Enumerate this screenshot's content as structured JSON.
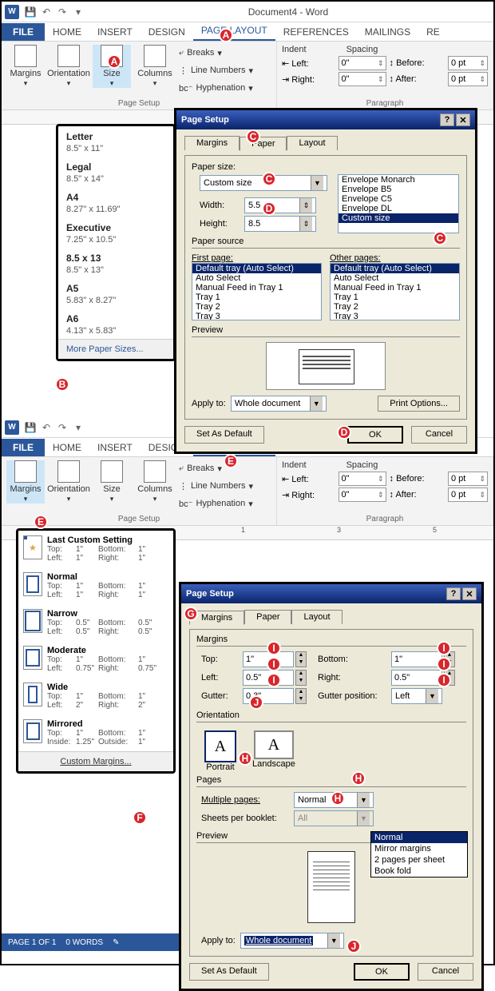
{
  "title": "Document4 - Word",
  "tabs": {
    "file": "FILE",
    "home": "HOME",
    "insert": "INSERT",
    "design": "DESIGN",
    "pagelayout": "PAGE LAYOUT",
    "references": "REFERENCES",
    "mailings": "MAILINGS",
    "re": "RE"
  },
  "ribbon": {
    "margins": "Margins",
    "orientation": "Orientation",
    "size": "Size",
    "columns": "Columns",
    "breaks": "Breaks",
    "linenumbers": "Line Numbers",
    "hyphenation": "Hyphenation",
    "pagesetup_label": "Page Setup",
    "indent_header": "Indent",
    "spacing_header": "Spacing",
    "left": "Left:",
    "right": "Right:",
    "before": "Before:",
    "after": "After:",
    "zero_in": "0\"",
    "zero_pt": "0 pt",
    "paragraph_label": "Paragraph"
  },
  "size_menu": {
    "letter": {
      "name": "Letter",
      "dim": "8.5\" x 11\""
    },
    "legal": {
      "name": "Legal",
      "dim": "8.5\" x 14\""
    },
    "a4": {
      "name": "A4",
      "dim": "8.27\" x 11.69\""
    },
    "executive": {
      "name": "Executive",
      "dim": "7.25\" x 10.5\""
    },
    "r85x13": {
      "name": "8.5 x 13",
      "dim": "8.5\" x 13\""
    },
    "a5": {
      "name": "A5",
      "dim": "5.83\" x 8.27\""
    },
    "a6": {
      "name": "A6",
      "dim": "4.13\" x 5.83\""
    },
    "more": "More Paper Sizes..."
  },
  "dlg1": {
    "title": "Page Setup",
    "tabs": {
      "margins": "Margins",
      "paper": "Paper",
      "layout": "Layout"
    },
    "paper_size": "Paper size:",
    "custom": "Custom size",
    "width": "Width:",
    "height": "Height:",
    "wval": "5.5",
    "hval": "8.5",
    "env_monarch": "Envelope Monarch",
    "env_b5": "Envelope B5",
    "env_c5": "Envelope C5",
    "env_dl": "Envelope DL",
    "paper_source": "Paper source",
    "first_page": "First page:",
    "other_pages": "Other pages:",
    "tray_default": "Default tray (Auto Select)",
    "tray_auto": "Auto Select",
    "tray_manual": "Manual Feed in Tray 1",
    "tray1": "Tray 1",
    "tray2": "Tray 2",
    "tray3": "Tray 3",
    "preview": "Preview",
    "apply_to": "Apply to:",
    "whole_doc": "Whole document",
    "print_options": "Print Options...",
    "set_default": "Set As Default",
    "ok": "OK",
    "cancel": "Cancel"
  },
  "margins_menu": {
    "last": {
      "name": "Last Custom Setting",
      "t": "1\"",
      "b": "1\"",
      "l": "1\"",
      "r": "1\""
    },
    "normal": {
      "name": "Normal",
      "t": "1\"",
      "b": "1\"",
      "l": "1\"",
      "r": "1\""
    },
    "narrow": {
      "name": "Narrow",
      "t": "0.5\"",
      "b": "0.5\"",
      "l": "0.5\"",
      "r": "0.5\""
    },
    "moderate": {
      "name": "Moderate",
      "t": "1\"",
      "b": "1\"",
      "l": "0.75\"",
      "r": "0.75\""
    },
    "wide": {
      "name": "Wide",
      "t": "1\"",
      "b": "1\"",
      "l": "2\"",
      "r": "2\""
    },
    "mirrored": {
      "name": "Mirrored",
      "t": "1\"",
      "b": "1\"",
      "l": "1.25\"",
      "r": "1\""
    },
    "top_l": "Top:",
    "bottom_l": "Bottom:",
    "left_l": "Left:",
    "right_l": "Right:",
    "inside_l": "Inside:",
    "outside_l": "Outside:",
    "custom": "Custom Margins..."
  },
  "dlg2": {
    "title": "Page Setup",
    "tabs": {
      "margins": "Margins",
      "paper": "Paper",
      "layout": "Layout"
    },
    "margins_h": "Margins",
    "top": "Top:",
    "bottom": "Bottom:",
    "left": "Left:",
    "right": "Right:",
    "gutter": "Gutter:",
    "gutter_pos": "Gutter position:",
    "t": "1\"",
    "b": "1\"",
    "l": "0.5\"",
    "r": "0.5\"",
    "g": "0.3\"",
    "gp": "Left",
    "orientation_h": "Orientation",
    "portrait": "Portrait",
    "landscape": "Landscape",
    "pages_h": "Pages",
    "multiple": "Multiple pages:",
    "normal": "Normal",
    "sheets": "Sheets per booklet:",
    "all": "All",
    "dd_normal": "Normal",
    "dd_mirror": "Mirror margins",
    "dd_2pp": "2 pages per sheet",
    "dd_book": "Book fold",
    "preview": "Preview",
    "apply_to": "Apply to:",
    "whole_doc": "Whole document",
    "set_default": "Set As Default",
    "ok": "OK",
    "cancel": "Cancel"
  },
  "statusbar": {
    "page": "PAGE 1 OF 1",
    "words": "0 WORDS"
  },
  "marks": {
    "A": "A",
    "B": "B",
    "C": "C",
    "D": "D",
    "E": "E",
    "F": "F",
    "G": "G",
    "H": "H",
    "I": "I",
    "J": "J"
  }
}
